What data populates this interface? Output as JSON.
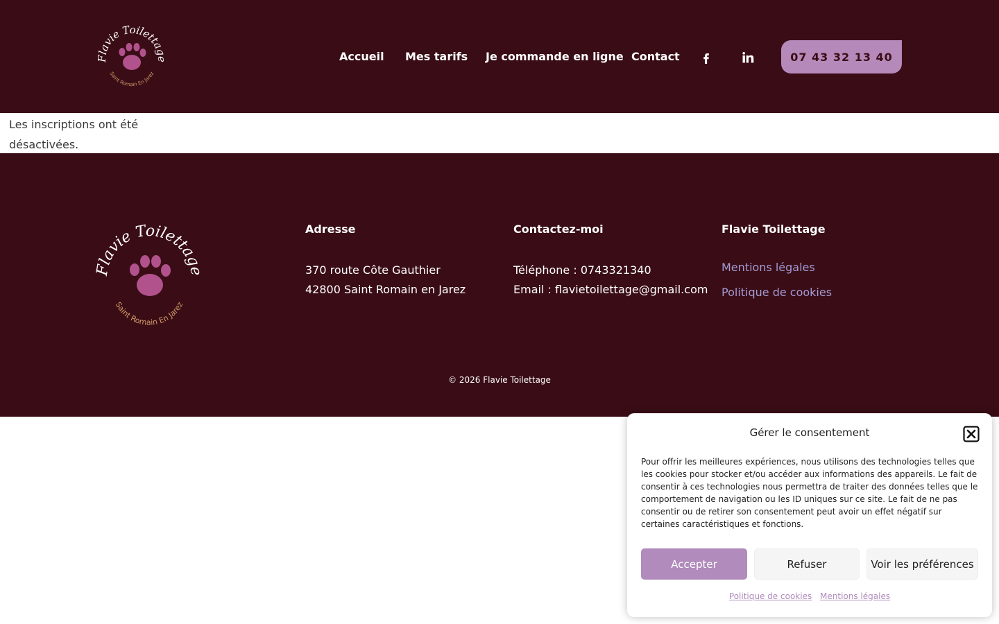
{
  "brand": {
    "name": "Flavie Toilettage",
    "tagline": "Saint Romain En Jarez"
  },
  "header": {
    "nav": [
      "Accueil",
      "Mes tarifs",
      "Je commande en ligne",
      "Contact"
    ],
    "social": [
      "facebook-icon",
      "linkedin-icon"
    ],
    "phone_button": "07 43 32 13 40"
  },
  "notice": {
    "text": "Les inscriptions ont été désactivées."
  },
  "footer": {
    "address": {
      "title": "Adresse",
      "line1": "370 route Côte Gauthier",
      "line2": "42800 Saint Romain en Jarez"
    },
    "contact": {
      "title": "Contactez-moi",
      "phone": "Téléphone : 0743321340",
      "email": "Email : flavietoilettage@gmail.com"
    },
    "links": {
      "title": "Flavie Toilettage",
      "items": [
        "Mentions légales",
        "Politique de cookies"
      ]
    },
    "copyright": "© 2026 Flavie Toilettage"
  },
  "consent": {
    "title": "Gérer le consentement",
    "body": "Pour offrir les meilleures expériences, nous utilisons des technologies telles que les cookies pour stocker et/ou accéder aux informations des appareils. Le fait de consentir à ces technologies nous permettra de traiter des données telles que le comportement de navigation ou les ID uniques sur ce site. Le fait de ne pas consentir ou de retirer son consentement peut avoir un effet négatif sur certaines caractéristiques et fonctions.",
    "accept": "Accepter",
    "refuse": "Refuser",
    "preferences": "Voir les préférences",
    "links": [
      "Politique de cookies",
      "Mentions légales"
    ]
  },
  "colors": {
    "header_bg": "#3a0d16",
    "accent": "#b58aba",
    "link": "#a49ad4"
  }
}
